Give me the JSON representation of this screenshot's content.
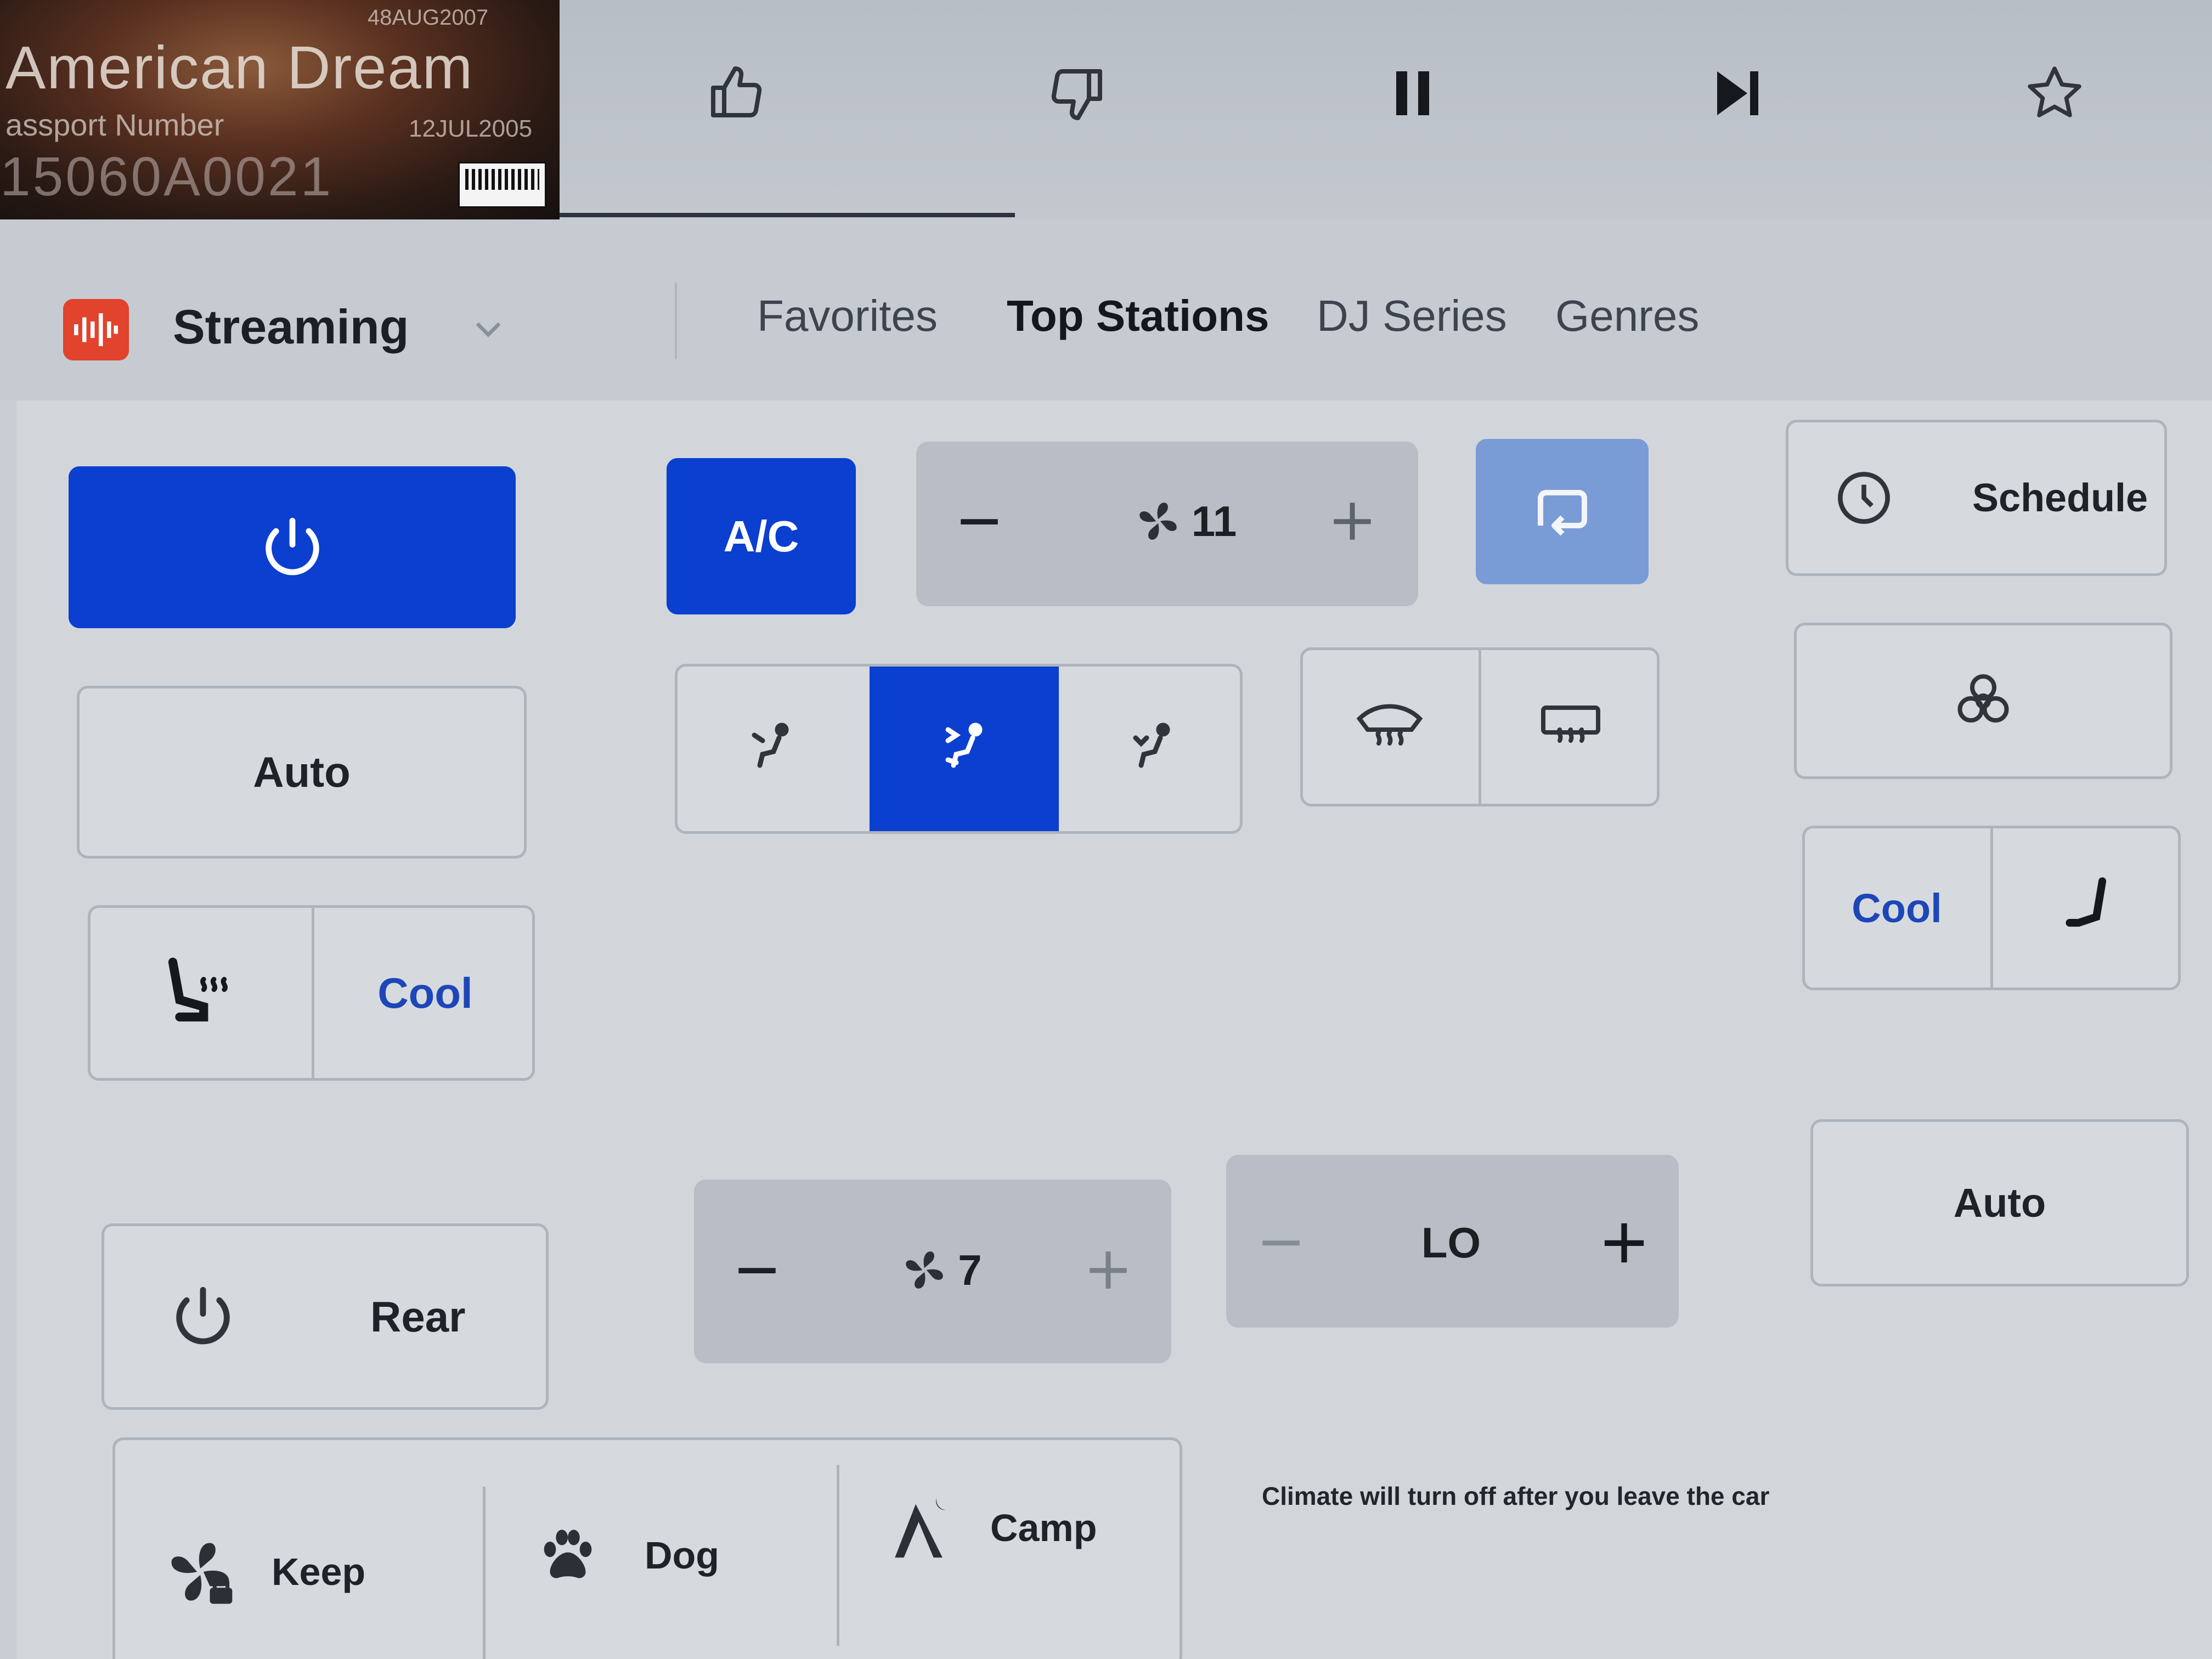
{
  "album": {
    "title_text": "American Dream",
    "passport_label": "assport Number",
    "passport_number": "15060A0021",
    "top_code": "48AUG2007",
    "issue_date": "12JUL2005"
  },
  "source": {
    "label": "Streaming"
  },
  "tabs": [
    {
      "label": "Favorites"
    },
    {
      "label": "Top Stations"
    },
    {
      "label": "DJ Series"
    },
    {
      "label": "Genres"
    }
  ],
  "climate": {
    "ac_label": "A/C",
    "front_fan_level": "11",
    "schedule_label": "Schedule",
    "auto_label": "Auto",
    "left_seat_mode": "Cool",
    "right_seat_mode": "Cool",
    "rear_label": "Rear",
    "rear_fan_level": "7",
    "rear_temp": "LO",
    "rear_auto_label": "Auto",
    "keep_label": "Keep",
    "dog_label": "Dog",
    "camp_label": "Camp",
    "note": "Climate will turn off after you leave the car"
  },
  "colors": {
    "accent_blue": "#0a3fcf",
    "source_red": "#e2432c"
  }
}
